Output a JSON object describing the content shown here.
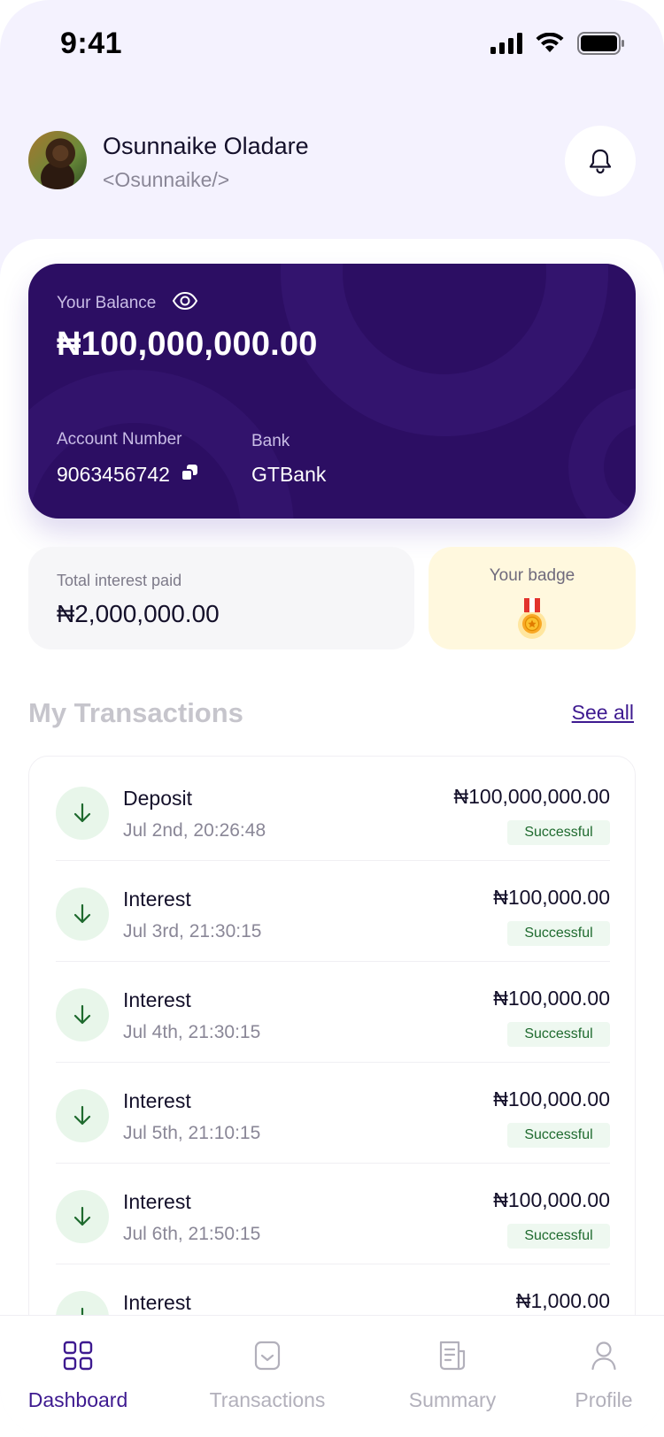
{
  "status_bar": {
    "time": "9:41"
  },
  "user": {
    "name": "Osunnaike Oladare",
    "handle": "<Osunnaike/>"
  },
  "balance_card": {
    "label": "Your Balance",
    "amount": "₦100,000,000.00",
    "account_label": "Account Number",
    "account_number": "9063456742",
    "bank_label": "Bank",
    "bank_name": "GTBank"
  },
  "interest": {
    "label": "Total interest paid",
    "value": "₦2,000,000.00"
  },
  "badge": {
    "label": "Your badge"
  },
  "transactions": {
    "title": "My Transactions",
    "see_all": "See all",
    "items": [
      {
        "type": "Deposit",
        "date": "Jul 2nd, 20:26:48",
        "amount": "₦100,000,000.00",
        "status": "Successful"
      },
      {
        "type": "Interest",
        "date": "Jul 3rd, 21:30:15",
        "amount": "₦100,000.00",
        "status": "Successful"
      },
      {
        "type": "Interest",
        "date": "Jul 4th, 21:30:15",
        "amount": "₦100,000.00",
        "status": "Successful"
      },
      {
        "type": "Interest",
        "date": "Jul 5th, 21:10:15",
        "amount": "₦100,000.00",
        "status": "Successful"
      },
      {
        "type": "Interest",
        "date": "Jul 6th, 21:50:15",
        "amount": "₦100,000.00",
        "status": "Successful"
      },
      {
        "type": "Interest",
        "date": "",
        "amount": "₦1,000.00",
        "status": ""
      }
    ]
  },
  "nav": {
    "items": [
      {
        "label": "Dashboard",
        "icon": "grid-icon",
        "active": true
      },
      {
        "label": "Transactions",
        "icon": "receipt-icon",
        "active": false
      },
      {
        "label": "Summary",
        "icon": "report-icon",
        "active": false
      },
      {
        "label": "Profile",
        "icon": "user-icon",
        "active": false
      }
    ]
  },
  "colors": {
    "primary": "#2c0e63",
    "accent": "#3e1a90",
    "background": "#f4f2fe",
    "success_text": "#1e6a2e",
    "success_bg": "#eef8f0",
    "badge_bg": "#fff8de"
  }
}
